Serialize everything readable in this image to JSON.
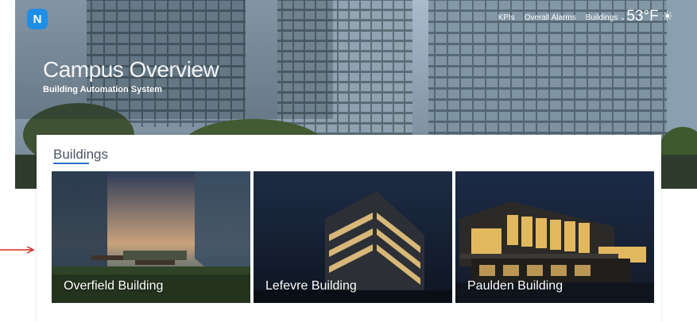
{
  "app": {
    "logo_letter": "N"
  },
  "nav": {
    "items": [
      {
        "label": "KPIs"
      },
      {
        "label": "Overall Alarms"
      },
      {
        "label": "Buildings",
        "chevron": "chevron-down-icon"
      }
    ]
  },
  "weather": {
    "temperature": "53°F",
    "icon": "sun-icon"
  },
  "hero": {
    "title": "Campus Overview",
    "subtitle": "Building Automation System"
  },
  "buildings_section": {
    "title": "Buildings",
    "accent_color": "#2f6fc4",
    "cards": [
      {
        "label": "Overfield Building"
      },
      {
        "label": "Lefevre Building"
      },
      {
        "label": "Paulden Building"
      }
    ]
  },
  "annotation": {
    "arrow_color": "#d9281e"
  }
}
